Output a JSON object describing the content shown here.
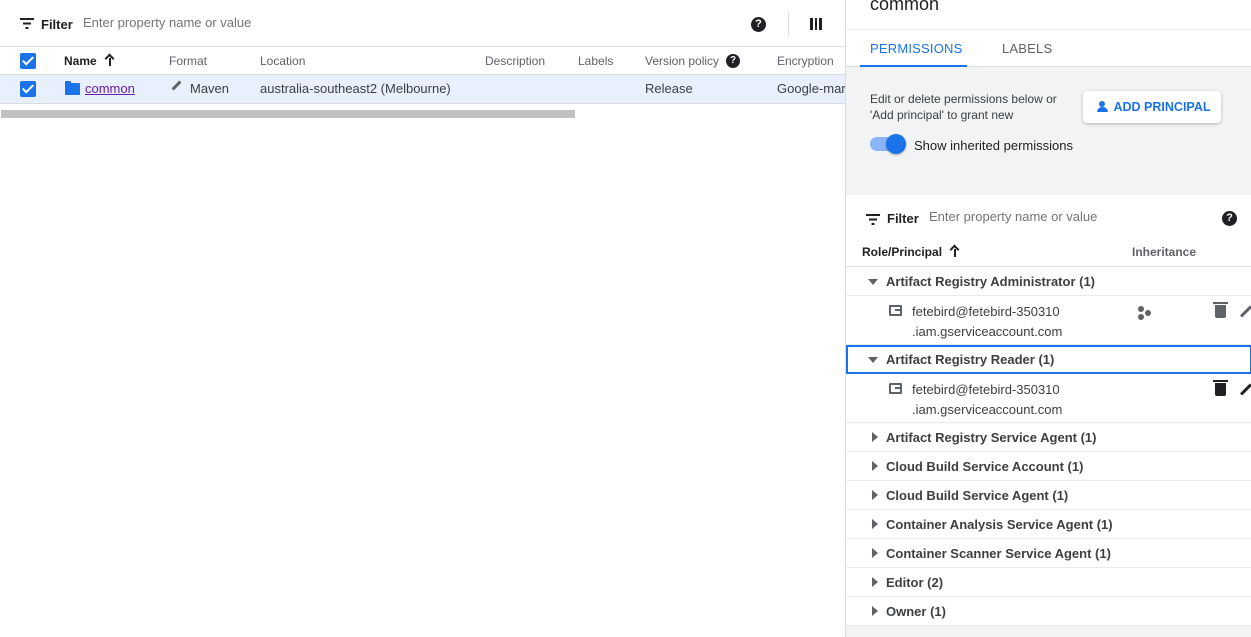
{
  "filter": {
    "label": "Filter",
    "placeholder": "Enter property name or value",
    "help": "?"
  },
  "table": {
    "headers": {
      "name": "Name",
      "format": "Format",
      "location": "Location",
      "description": "Description",
      "labels": "Labels",
      "version_policy": "Version policy",
      "encryption": "Encryption"
    },
    "row": {
      "name": "common",
      "format": "Maven",
      "location": "australia-southeast2 (Melbourne)",
      "version_policy": "Release",
      "encryption": "Google-mar"
    }
  },
  "panel": {
    "title": "common",
    "tabs": [
      "PERMISSIONS",
      "LABELS"
    ],
    "description": "Edit or delete permissions below or 'Add principal' to grant new",
    "add_button": "ADD PRINCIPAL",
    "toggle_label": "Show inherited permissions",
    "filter": {
      "label": "Filter",
      "placeholder": "Enter property name or value"
    },
    "headers": {
      "role": "Role/Principal",
      "inheritance": "Inheritance"
    },
    "groups": [
      {
        "label": "Artifact Registry Administrator (1)",
        "expanded": true
      },
      {
        "label": "Artifact Registry Reader (1)",
        "expanded": true
      },
      {
        "label": "Artifact Registry Service Agent (1)",
        "expanded": false
      },
      {
        "label": "Cloud Build Service Account (1)",
        "expanded": false
      },
      {
        "label": "Cloud Build Service Agent (1)",
        "expanded": false
      },
      {
        "label": "Container Analysis Service Agent (1)",
        "expanded": false
      },
      {
        "label": "Container Scanner Service Agent (1)",
        "expanded": false
      },
      {
        "label": "Editor (2)",
        "expanded": false
      },
      {
        "label": "Owner (1)",
        "expanded": false
      }
    ],
    "members": [
      {
        "line1": "fetebird@fetebird-350310",
        "line2": ".iam.gserviceaccount.com"
      },
      {
        "line1": "fetebird@fetebird-350310",
        "line2": ".iam.gserviceaccount.com"
      }
    ]
  }
}
